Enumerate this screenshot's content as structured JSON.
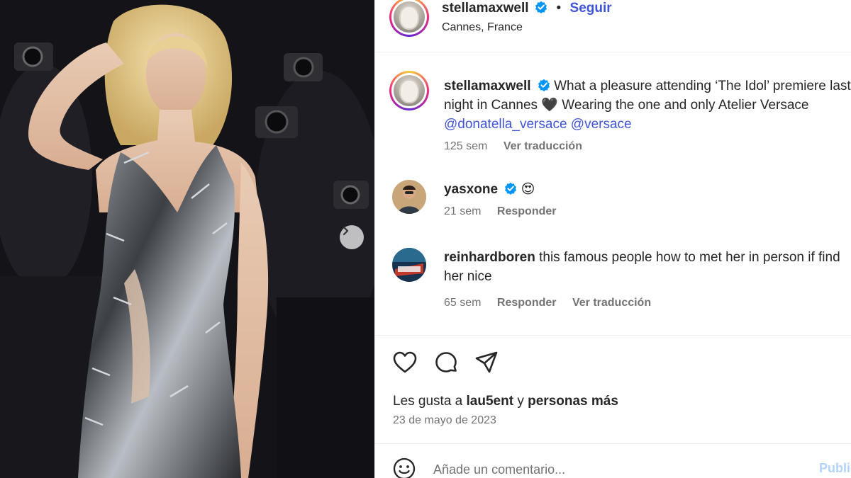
{
  "post": {
    "image_alt": "Rubia en vestido metálico plateado en alfombra roja",
    "next_icon": "chevron-right-icon"
  },
  "header": {
    "username": "stellamaxwell",
    "dot": "•",
    "follow_label": "Seguir",
    "location": "Cannes, France"
  },
  "caption": {
    "username": "stellamaxwell",
    "text_a": "What a pleasure attending ‘The Idol’ premiere last",
    "text_b": "night in Cannes",
    "heart": "🖤",
    "text_c": "Wearing the one and only Atelier Versace",
    "mention_1": "@donatella_versace",
    "mention_2": "@versace",
    "time": "125 sem",
    "translate": "Ver traducción"
  },
  "comments": [
    {
      "username": "yasxone",
      "text": "😍",
      "time": "21 sem",
      "reply": "Responder"
    },
    {
      "username": "reinhardboren",
      "text": "this famous people how to met her in person if find her nice",
      "time": "65 sem",
      "reply": "Responder",
      "translate": "Ver traducción"
    }
  ],
  "actions": {
    "likes_prefix": "Les gusta a",
    "likes_user": "lau5ent",
    "likes_mid": "y",
    "likes_suffix": "personas más",
    "date": "23 de mayo de 2023"
  },
  "comment_box": {
    "placeholder": "Añade un comentario...",
    "publish": "Publicar"
  },
  "colors": {
    "link": "#3f55d6",
    "verified": "#0095f6",
    "muted": "#737373"
  }
}
